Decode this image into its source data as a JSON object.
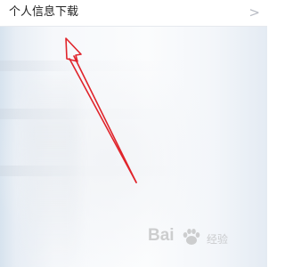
{
  "menu": {
    "download_personal_info_label": "个人信息下载",
    "chevron_glyph": ">"
  },
  "annotation": {
    "arrow_color": "#e0242b"
  },
  "watermark": {
    "brand_left": "Bai",
    "brand_right": "经验",
    "icon": "paw-icon"
  },
  "colors": {
    "text": "#222222",
    "chevron": "#b8bcc4",
    "divider": "#e6e9ee"
  }
}
